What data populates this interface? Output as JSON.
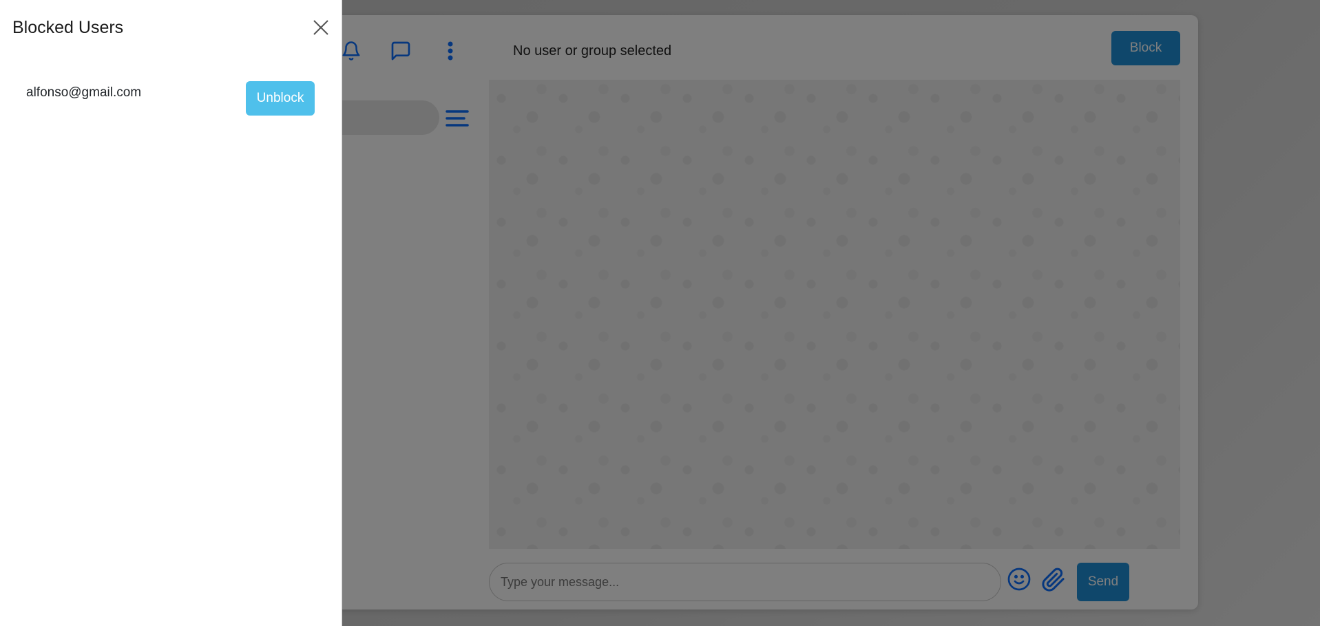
{
  "app": {
    "chat_title": "No user or group selected",
    "block_label": "Block",
    "message_placeholder": "Type your message...",
    "send_label": "Send",
    "icons": [
      "bell-icon",
      "chat-icon",
      "more-vertical-icon",
      "menu-icon",
      "emoji-icon",
      "paperclip-icon"
    ],
    "accent_color": "#1e8fd6"
  },
  "panel": {
    "title": "Blocked Users",
    "close_icon": "close-icon",
    "blocked_users": [
      {
        "email": "alfonso@gmail.com",
        "action_label": "Unblock"
      }
    ],
    "unblock_color": "#4fc0eb"
  }
}
